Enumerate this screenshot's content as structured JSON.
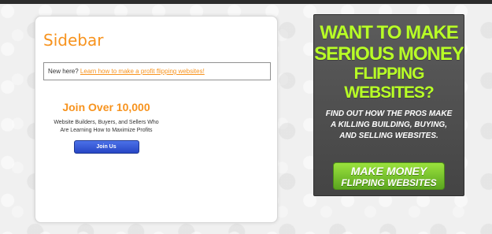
{
  "sidebar": {
    "title": "Sidebar",
    "notice": {
      "prefix": "New here?",
      "link_text": "Learn how to make a profit flipping websites!"
    }
  },
  "join": {
    "heading": "Join Over 10,000",
    "subtext_line1": "Website Builders, Buyers, and Sellers Who",
    "subtext_line2": "Are Learning How to Maximize Profits",
    "button_label": "Join Us"
  },
  "ad": {
    "headline_line1": "Want to Make",
    "headline_line2": "Serious Money",
    "headline_line3": "Flipping Websites?",
    "subtext_line1": "Find out how the pros make",
    "subtext_line2": "a killing building, buying,",
    "subtext_line3": "and selling websites.",
    "button_line1": "Make Money",
    "button_line2": "Flipping Websites"
  },
  "colors": {
    "accent_orange": "#f7931e",
    "ad_green": "#b8ff26",
    "button_blue": "#3157d6",
    "ad_button_green": "#7dc92d"
  }
}
